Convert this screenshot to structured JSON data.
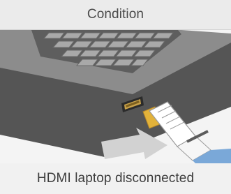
{
  "header": {
    "title": "Condition"
  },
  "illustration": {
    "icon": "hdmi-laptop-disconnected-illustration"
  },
  "caption": {
    "text": "HDMI laptop disconnected"
  },
  "colors": {
    "header_bg": "#ebebeb",
    "laptop_body": "#6d6d6d",
    "laptop_keys": "#bdbdbd",
    "arrow": "#d6d6d6",
    "cable_white": "#ffffff",
    "cable_blue": "#7aa8d8"
  }
}
